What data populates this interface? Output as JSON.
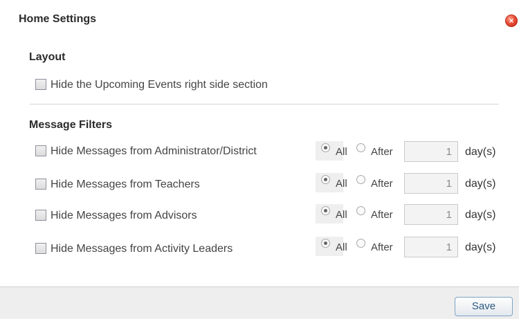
{
  "dialog": {
    "title": "Home Settings",
    "close_icon": "close-icon",
    "accent_color": "#d9462f"
  },
  "layout_section": {
    "heading": "Layout",
    "option": {
      "label": "Hide the Upcoming Events right side section",
      "checked": false
    }
  },
  "filters_section": {
    "heading": "Message Filters",
    "rows": [
      {
        "label": "Hide Messages from Administrator/District",
        "checked": false,
        "radio_all": "All",
        "radio_after": "After",
        "selected": "All",
        "days": "1",
        "unit": "day(s)"
      },
      {
        "label": "Hide Messages from Teachers",
        "checked": false,
        "radio_all": "All",
        "radio_after": "After",
        "selected": "All",
        "days": "1",
        "unit": "day(s)"
      },
      {
        "label": "Hide Messages from Advisors",
        "checked": false,
        "radio_all": "All",
        "radio_after": "After",
        "selected": "All",
        "days": "1",
        "unit": "day(s)"
      },
      {
        "label": "Hide Messages from Activity Leaders",
        "checked": false,
        "radio_all": "All",
        "radio_after": "After",
        "selected": "All",
        "days": "1",
        "unit": "day(s)"
      }
    ]
  },
  "footer": {
    "save_label": "Save"
  }
}
